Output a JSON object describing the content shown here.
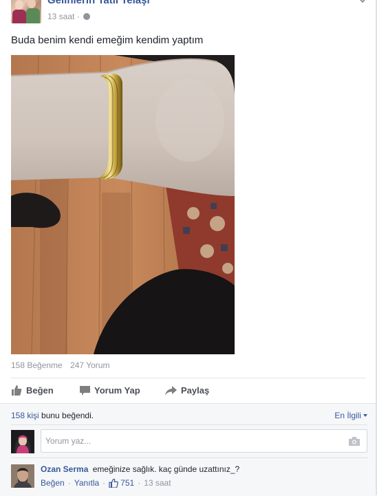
{
  "header": {
    "group_name": "Gelinlerin Tatil Telaşı",
    "time": "13 saat",
    "separator": "·"
  },
  "post": {
    "text": "Buda benim kendi emeğim kendim yaptım"
  },
  "stats": {
    "likes": "158 Beğenme",
    "comments": "247 Yorum"
  },
  "actions": {
    "like": "Beğen",
    "comment": "Yorum Yap",
    "share": "Paylaş"
  },
  "feedback": {
    "likes_count_link": "158 kişi",
    "likes_suffix": "bunu beğendi.",
    "sort_label": "En İlgili"
  },
  "composer": {
    "placeholder": "Yorum yaz..."
  },
  "comment": {
    "author": "Ozan Serma",
    "text": "emeğinize sağlık. kaç günde uzattınız_?",
    "like_action": "Beğen",
    "reply_action": "Yanıtla",
    "like_count": "751",
    "time": "13 saat"
  },
  "colors": {
    "link": "#365899",
    "secondary_text": "#90949c",
    "feedback_bg": "#f6f7f9"
  }
}
